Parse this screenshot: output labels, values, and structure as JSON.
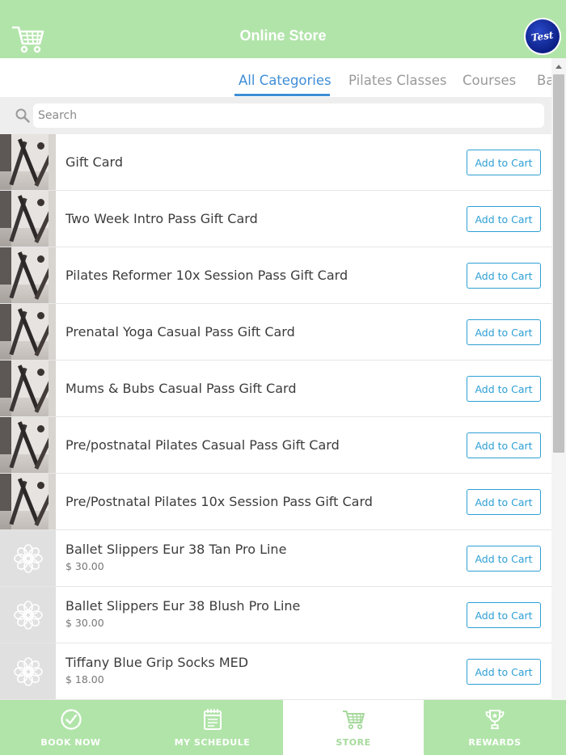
{
  "header": {
    "title": "Online Store",
    "avatar_text": "Test",
    "cart_icon": "shopping-cart-icon"
  },
  "tabs": [
    {
      "label": "All Categories",
      "active": true
    },
    {
      "label": "Pilates Classes",
      "active": false
    },
    {
      "label": "Courses",
      "active": false
    },
    {
      "label": "Ba",
      "active": false
    }
  ],
  "search": {
    "placeholder": "Search",
    "value": ""
  },
  "products": [
    {
      "name": "Gift Card",
      "price": "",
      "thumb": "photo"
    },
    {
      "name": "Two Week Intro Pass Gift Card",
      "price": "",
      "thumb": "photo"
    },
    {
      "name": "Pilates Reformer 10x Session Pass Gift Card",
      "price": "",
      "thumb": "photo"
    },
    {
      "name": "Prenatal Yoga Casual Pass Gift Card",
      "price": "",
      "thumb": "photo"
    },
    {
      "name": "Mums & Bubs Casual Pass Gift Card",
      "price": "",
      "thumb": "photo"
    },
    {
      "name": "Pre/postnatal Pilates Casual Pass Gift Card",
      "price": "",
      "thumb": "photo"
    },
    {
      "name": "Pre/Postnatal Pilates 10x Session Pass Gift Card",
      "price": "",
      "thumb": "photo"
    },
    {
      "name": "Ballet Slippers Eur 38 Tan Pro Line",
      "price": "$ 30.00",
      "thumb": "flower"
    },
    {
      "name": "Ballet Slippers Eur 38 Blush Pro Line",
      "price": "$ 30.00",
      "thumb": "flower"
    },
    {
      "name": "Tiffany Blue Grip Socks MED",
      "price": "$ 18.00",
      "thumb": "flower"
    }
  ],
  "add_to_cart_label": "Add to Cart",
  "bottom_nav": [
    {
      "label": "BOOK NOW",
      "icon": "check-circle-icon",
      "active": false
    },
    {
      "label": "MY SCHEDULE",
      "icon": "calendar-icon",
      "active": false
    },
    {
      "label": "STORE",
      "icon": "shopping-cart-icon",
      "active": true
    },
    {
      "label": "REWARDS",
      "icon": "trophy-icon",
      "active": false
    }
  ],
  "colors": {
    "header_bg": "#b1e4a9",
    "accent_blue": "#3f8ed6",
    "button_blue": "#2d9fd4"
  }
}
